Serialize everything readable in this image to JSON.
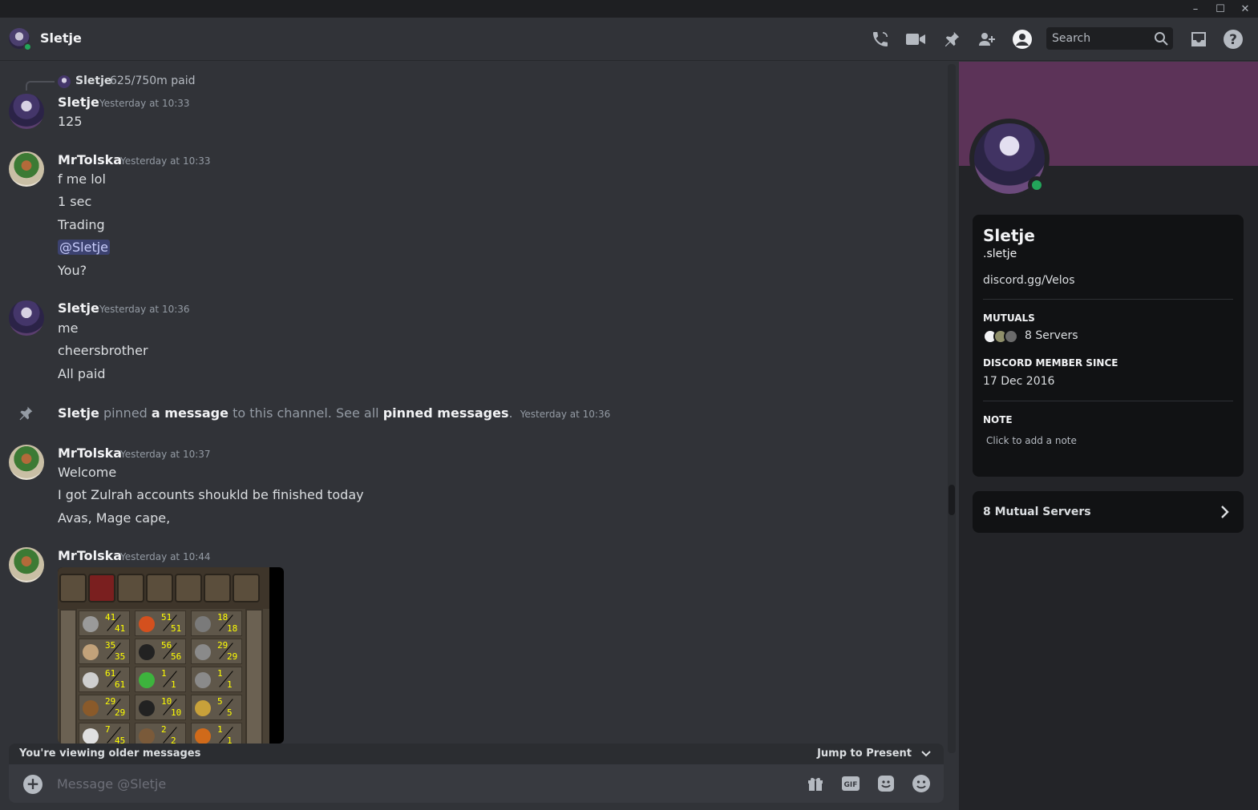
{
  "window": {
    "minimize": "–",
    "maximize": "☐",
    "close": "✕"
  },
  "header": {
    "title": "Sletje",
    "search_placeholder": "Search"
  },
  "reply": {
    "author": "Sletje",
    "text": "625/750m paid"
  },
  "messages": [
    {
      "author": "Sletje",
      "time": "Yesterday at 10:33",
      "lines": [
        "125"
      ]
    },
    {
      "author": "MrTolska",
      "time": "Yesterday at 10:33",
      "lines": [
        "f me lol",
        "1 sec",
        "Trading",
        "@Sletje",
        "You?"
      ]
    },
    {
      "author": "Sletje",
      "time": "Yesterday at 10:36",
      "lines": [
        "me",
        "cheersbrother",
        "All paid"
      ]
    },
    {
      "author": "MrTolska",
      "time": "Yesterday at 10:37",
      "lines": [
        "Welcome",
        "I got Zulrah accounts shoukld be finished today",
        "Avas, Mage cape,"
      ]
    },
    {
      "author": "MrTolska",
      "time": "Yesterday at 10:44",
      "lines": []
    }
  ],
  "system": {
    "author": "Sletje",
    "t1": "pinned",
    "link1": "a message",
    "t2": "to this channel. See all",
    "link2": "pinned messages",
    "t3": ".",
    "time": "Yesterday at 10:36"
  },
  "osrs_skills": [
    [
      "41",
      "41"
    ],
    [
      "51",
      "51"
    ],
    [
      "18",
      "18"
    ],
    [
      "35",
      "35"
    ],
    [
      "56",
      "56"
    ],
    [
      "29",
      "29"
    ],
    [
      "61",
      "61"
    ],
    [
      "1",
      "1"
    ],
    [
      "1",
      "1"
    ],
    [
      "29",
      "29"
    ],
    [
      "10",
      "10"
    ],
    [
      "5",
      "5"
    ],
    [
      "7",
      "45"
    ],
    [
      "2",
      "2"
    ],
    [
      "1",
      "1"
    ]
  ],
  "colors": {
    "accent_green": "#23a55a",
    "banner": "#5c3358",
    "mention_bg": "#3c4270"
  },
  "composer": {
    "older_text": "You're viewing older messages",
    "jump_label": "Jump to Present",
    "placeholder": "Message @Sletje",
    "gif": "GIF"
  },
  "profile": {
    "name": "Sletje",
    "username": ".sletje",
    "bio": "discord.gg/Velos",
    "mutuals_heading": "MUTUALS",
    "mutuals_text": "8 Servers",
    "since_heading": "DISCORD MEMBER SINCE",
    "since_date": "17 Dec 2016",
    "note_heading": "NOTE",
    "note_placeholder": "Click to add a note",
    "mutual_servers_button": "8 Mutual Servers"
  }
}
